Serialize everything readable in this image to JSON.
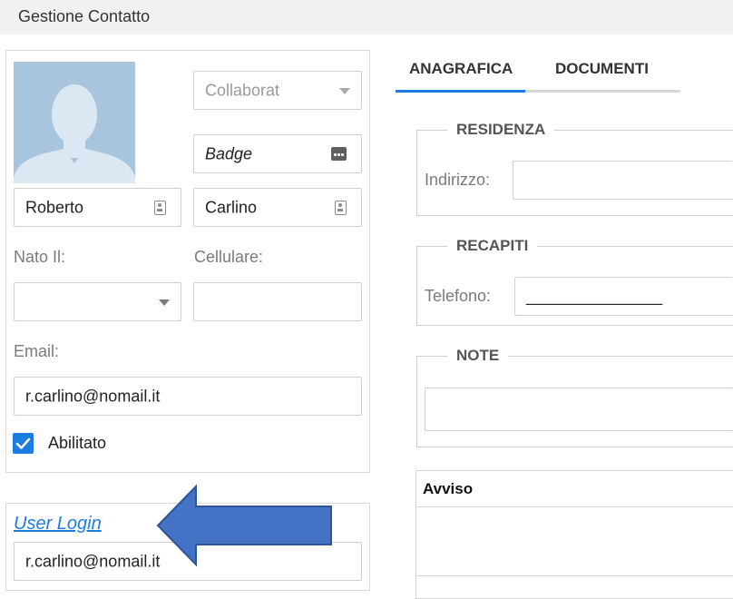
{
  "window": {
    "title": "Gestione Contatto"
  },
  "contact": {
    "type_placeholder": "Collaborat",
    "badge_value": "Badge",
    "first_name": "Roberto",
    "last_name": "Carlino",
    "born_label": "Nato Il:",
    "born_value": "",
    "mobile_label": "Cellulare:",
    "mobile_value": "",
    "email_label": "Email:",
    "email_value": "r.carlino@nomail.it",
    "enabled_label": "Abilitato",
    "enabled": true
  },
  "login": {
    "link_label": "User Login",
    "value": "r.carlino@nomail.it"
  },
  "tabs": [
    {
      "label": "ANAGRAFICA",
      "active": true
    },
    {
      "label": "DOCUMENTI",
      "active": false
    }
  ],
  "residenza": {
    "legend": "RESIDENZA",
    "address_label": "Indirizzo:",
    "address_value": ""
  },
  "recapiti": {
    "legend": "RECAPITI",
    "phone_label": "Telefono:",
    "phone_value": "_______________"
  },
  "note": {
    "legend": "NOTE",
    "value": ""
  },
  "notice": {
    "title": "Avviso"
  },
  "colors": {
    "accent": "#1d7ce0",
    "arrow": "#4472c4",
    "avatar_bg": "#a9c5de"
  },
  "icons": [
    "avatar-placeholder-icon",
    "chevron-down-icon",
    "badge-card-icon",
    "contact-card-icon",
    "checkmark-icon",
    "arrow-left-icon"
  ]
}
